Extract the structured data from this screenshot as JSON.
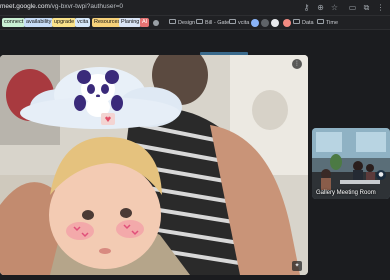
{
  "browser": {
    "url_prefix": "meet.google.com",
    "url_path": "/vg-bxvr-twpi?authuser=0",
    "bookmarks": [
      {
        "label": "connect",
        "color": "#c9f0d4"
      },
      {
        "label": "availability",
        "color": "#c7ddf7"
      },
      {
        "label": "upgrade",
        "color": "#f9e28a"
      },
      {
        "label": "vcita",
        "color": "#d6e8fa"
      },
      {
        "label": "Resources",
        "color": "#f6d17a"
      },
      {
        "label": "Planing",
        "color": "#d9e4f5"
      },
      {
        "label": "AI",
        "color": "#e57373"
      }
    ],
    "folders": [
      {
        "label": "Design"
      },
      {
        "label": "Bill - Gate"
      },
      {
        "label": "vcita"
      }
    ],
    "folders_right": [
      {
        "label": "Data"
      },
      {
        "label": "Time"
      }
    ]
  },
  "meet": {
    "main_tile": {
      "more_icon": "more-options-icon",
      "effects_icon": "visual-effects-icon"
    },
    "side_tile": {
      "name": "Gallery Meeting Room"
    }
  }
}
